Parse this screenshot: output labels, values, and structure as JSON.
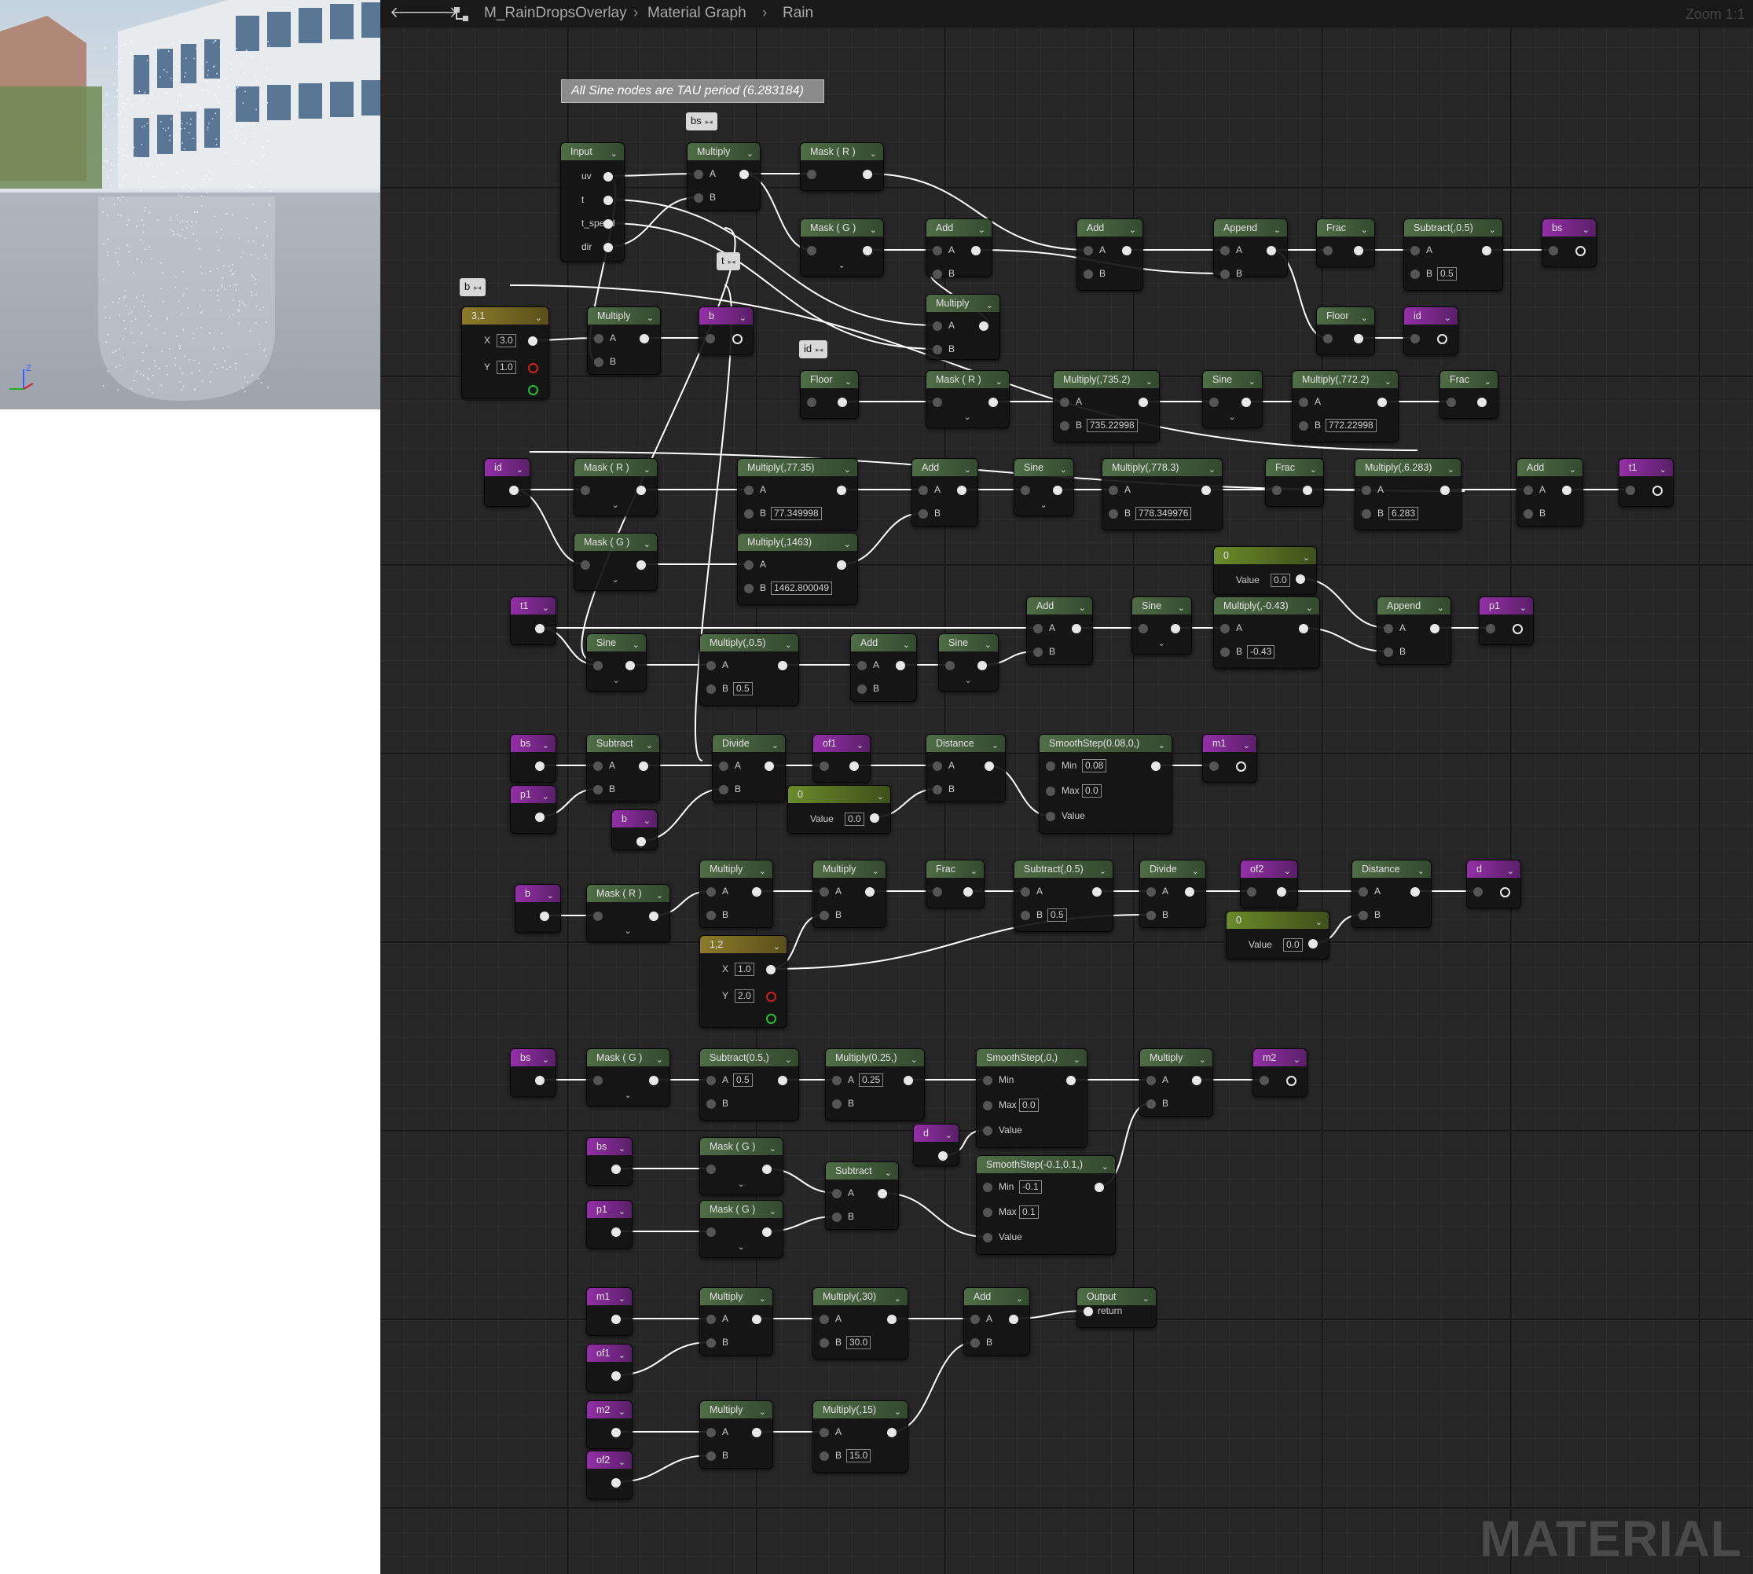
{
  "breadcrumb": {
    "asset": "M_RainDropsOverlay",
    "graph": "Material Graph",
    "function": "Rain"
  },
  "zoom": "Zoom 1:1",
  "watermark": "MATERIAL",
  "comment": "All Sine nodes are TAU period (6.283184)",
  "bubbles": {
    "bs": "bs",
    "t": "t",
    "b": "b",
    "id": "id"
  },
  "nodes": {
    "input": {
      "title": "Input",
      "p0": "uv",
      "p1": "t",
      "p2": "t_speed",
      "p3": "dir"
    },
    "mul_uv": {
      "title": "Multiply"
    },
    "mask_r1": {
      "title": "Mask ( R )"
    },
    "mask_g1": {
      "title": "Mask ( G )"
    },
    "add1": {
      "title": "Add"
    },
    "mul2": {
      "title": "Multiply"
    },
    "add2": {
      "title": "Add"
    },
    "append1": {
      "title": "Append"
    },
    "frac1": {
      "title": "Frac"
    },
    "sub05": {
      "title": "Subtract(,0.5)",
      "b": "0.5"
    },
    "bs_out": {
      "title": "bs"
    },
    "floor2": {
      "title": "Floor"
    },
    "id_out": {
      "title": "id"
    },
    "c31": {
      "title": "3,1",
      "x": "3.0",
      "y": "1.0"
    },
    "mul_b": {
      "title": "Multiply"
    },
    "b_out": {
      "title": "b"
    },
    "floor1": {
      "title": "Floor"
    },
    "mask_r2": {
      "title": "Mask ( R )"
    },
    "mul7352": {
      "title": "Multiply(,735.2)",
      "b": "735.22998"
    },
    "sine1": {
      "title": "Sine"
    },
    "mul7722": {
      "title": "Multiply(,772.2)",
      "b": "772.22998"
    },
    "frac2": {
      "title": "Frac"
    },
    "id_in": {
      "title": "id"
    },
    "mask_r3": {
      "title": "Mask ( R )"
    },
    "mask_g3": {
      "title": "Mask ( G )"
    },
    "mul7735": {
      "title": "Multiply(,77.35)",
      "b": "77.349998"
    },
    "mul1463": {
      "title": "Multiply(,1463)",
      "b": "1462.800049"
    },
    "add3": {
      "title": "Add"
    },
    "sine2": {
      "title": "Sine"
    },
    "mul7783": {
      "title": "Multiply(,778.3)",
      "b": "778.349976"
    },
    "frac3": {
      "title": "Frac"
    },
    "mul6283": {
      "title": "Multiply(,6.283)",
      "b": "6.283"
    },
    "add4": {
      "title": "Add"
    },
    "t1_out": {
      "title": "t1"
    },
    "t1_in": {
      "title": "t1"
    },
    "sine3": {
      "title": "Sine"
    },
    "mul05": {
      "title": "Multiply(,0.5)",
      "b": "0.5"
    },
    "add5": {
      "title": "Add"
    },
    "sine4": {
      "title": "Sine"
    },
    "add6": {
      "title": "Add"
    },
    "sine5": {
      "title": "Sine"
    },
    "const0a": {
      "title": "0",
      "value": "0.0"
    },
    "mulm043": {
      "title": "Multiply(,-0.43)",
      "b": "-0.43"
    },
    "append2": {
      "title": "Append"
    },
    "p1_out": {
      "title": "p1"
    },
    "bs_in1": {
      "title": "bs"
    },
    "p1_in1": {
      "title": "p1"
    },
    "subtract1": {
      "title": "Subtract"
    },
    "b_in1": {
      "title": "b"
    },
    "divide1": {
      "title": "Divide"
    },
    "of1_var": {
      "title": "of1"
    },
    "const0b": {
      "title": "0",
      "value": "0.0"
    },
    "distance1": {
      "title": "Distance"
    },
    "smooth1": {
      "title": "SmoothStep(0.08,0,)",
      "min": "0.08",
      "max": "0.0"
    },
    "m1_out": {
      "title": "m1"
    },
    "b_in2": {
      "title": "b"
    },
    "mask_r4": {
      "title": "Mask ( R )"
    },
    "mul3": {
      "title": "Multiply"
    },
    "c12": {
      "title": "1,2",
      "x": "1.0",
      "y": "2.0"
    },
    "mul4": {
      "title": "Multiply"
    },
    "frac4": {
      "title": "Frac"
    },
    "sub05b": {
      "title": "Subtract(,0.5)",
      "b": "0.5"
    },
    "divide2": {
      "title": "Divide"
    },
    "of2_var": {
      "title": "of2"
    },
    "const0c": {
      "title": "0",
      "value": "0.0"
    },
    "distance2": {
      "title": "Distance"
    },
    "d_out": {
      "title": "d"
    },
    "bs_in2": {
      "title": "bs"
    },
    "mask_g4": {
      "title": "Mask ( G )"
    },
    "sub05c": {
      "title": "Subtract(0.5,)",
      "a": "0.5"
    },
    "mul025": {
      "title": "Multiply(0.25,)",
      "a": "0.25"
    },
    "smooth2": {
      "title": "SmoothStep(,0,)",
      "max": "0.0"
    },
    "mul5": {
      "title": "Multiply"
    },
    "m2_out": {
      "title": "m2"
    },
    "d_in": {
      "title": "d"
    },
    "bs_in3": {
      "title": "bs"
    },
    "mask_g5": {
      "title": "Mask ( G )"
    },
    "p1_in2": {
      "title": "p1"
    },
    "mask_g6": {
      "title": "Mask ( G )"
    },
    "subtract2": {
      "title": "Subtract"
    },
    "smooth3": {
      "title": "SmoothStep(-0.1,0.1,)",
      "min": "-0.1",
      "max": "0.1"
    },
    "m1_in": {
      "title": "m1"
    },
    "of1_in": {
      "title": "of1"
    },
    "mul6": {
      "title": "Multiply"
    },
    "mul30": {
      "title": "Multiply(,30)",
      "b": "30.0"
    },
    "add7": {
      "title": "Add"
    },
    "output": {
      "title": "Output",
      "p0": "return"
    },
    "m2_in": {
      "title": "m2"
    },
    "of2_in": {
      "title": "of2"
    },
    "mul7": {
      "title": "Multiply"
    },
    "mul15": {
      "title": "Multiply(,15)",
      "b": "15.0"
    }
  },
  "pins": {
    "A": "A",
    "B": "B",
    "X": "X",
    "Y": "Y",
    "Min": "Min",
    "Max": "Max",
    "Value": "Value"
  },
  "colors": {
    "grid_bg": "#262626",
    "node_header": "#4f6d46",
    "var_header": "#9330a6",
    "vector_header": "#8c7a29"
  }
}
